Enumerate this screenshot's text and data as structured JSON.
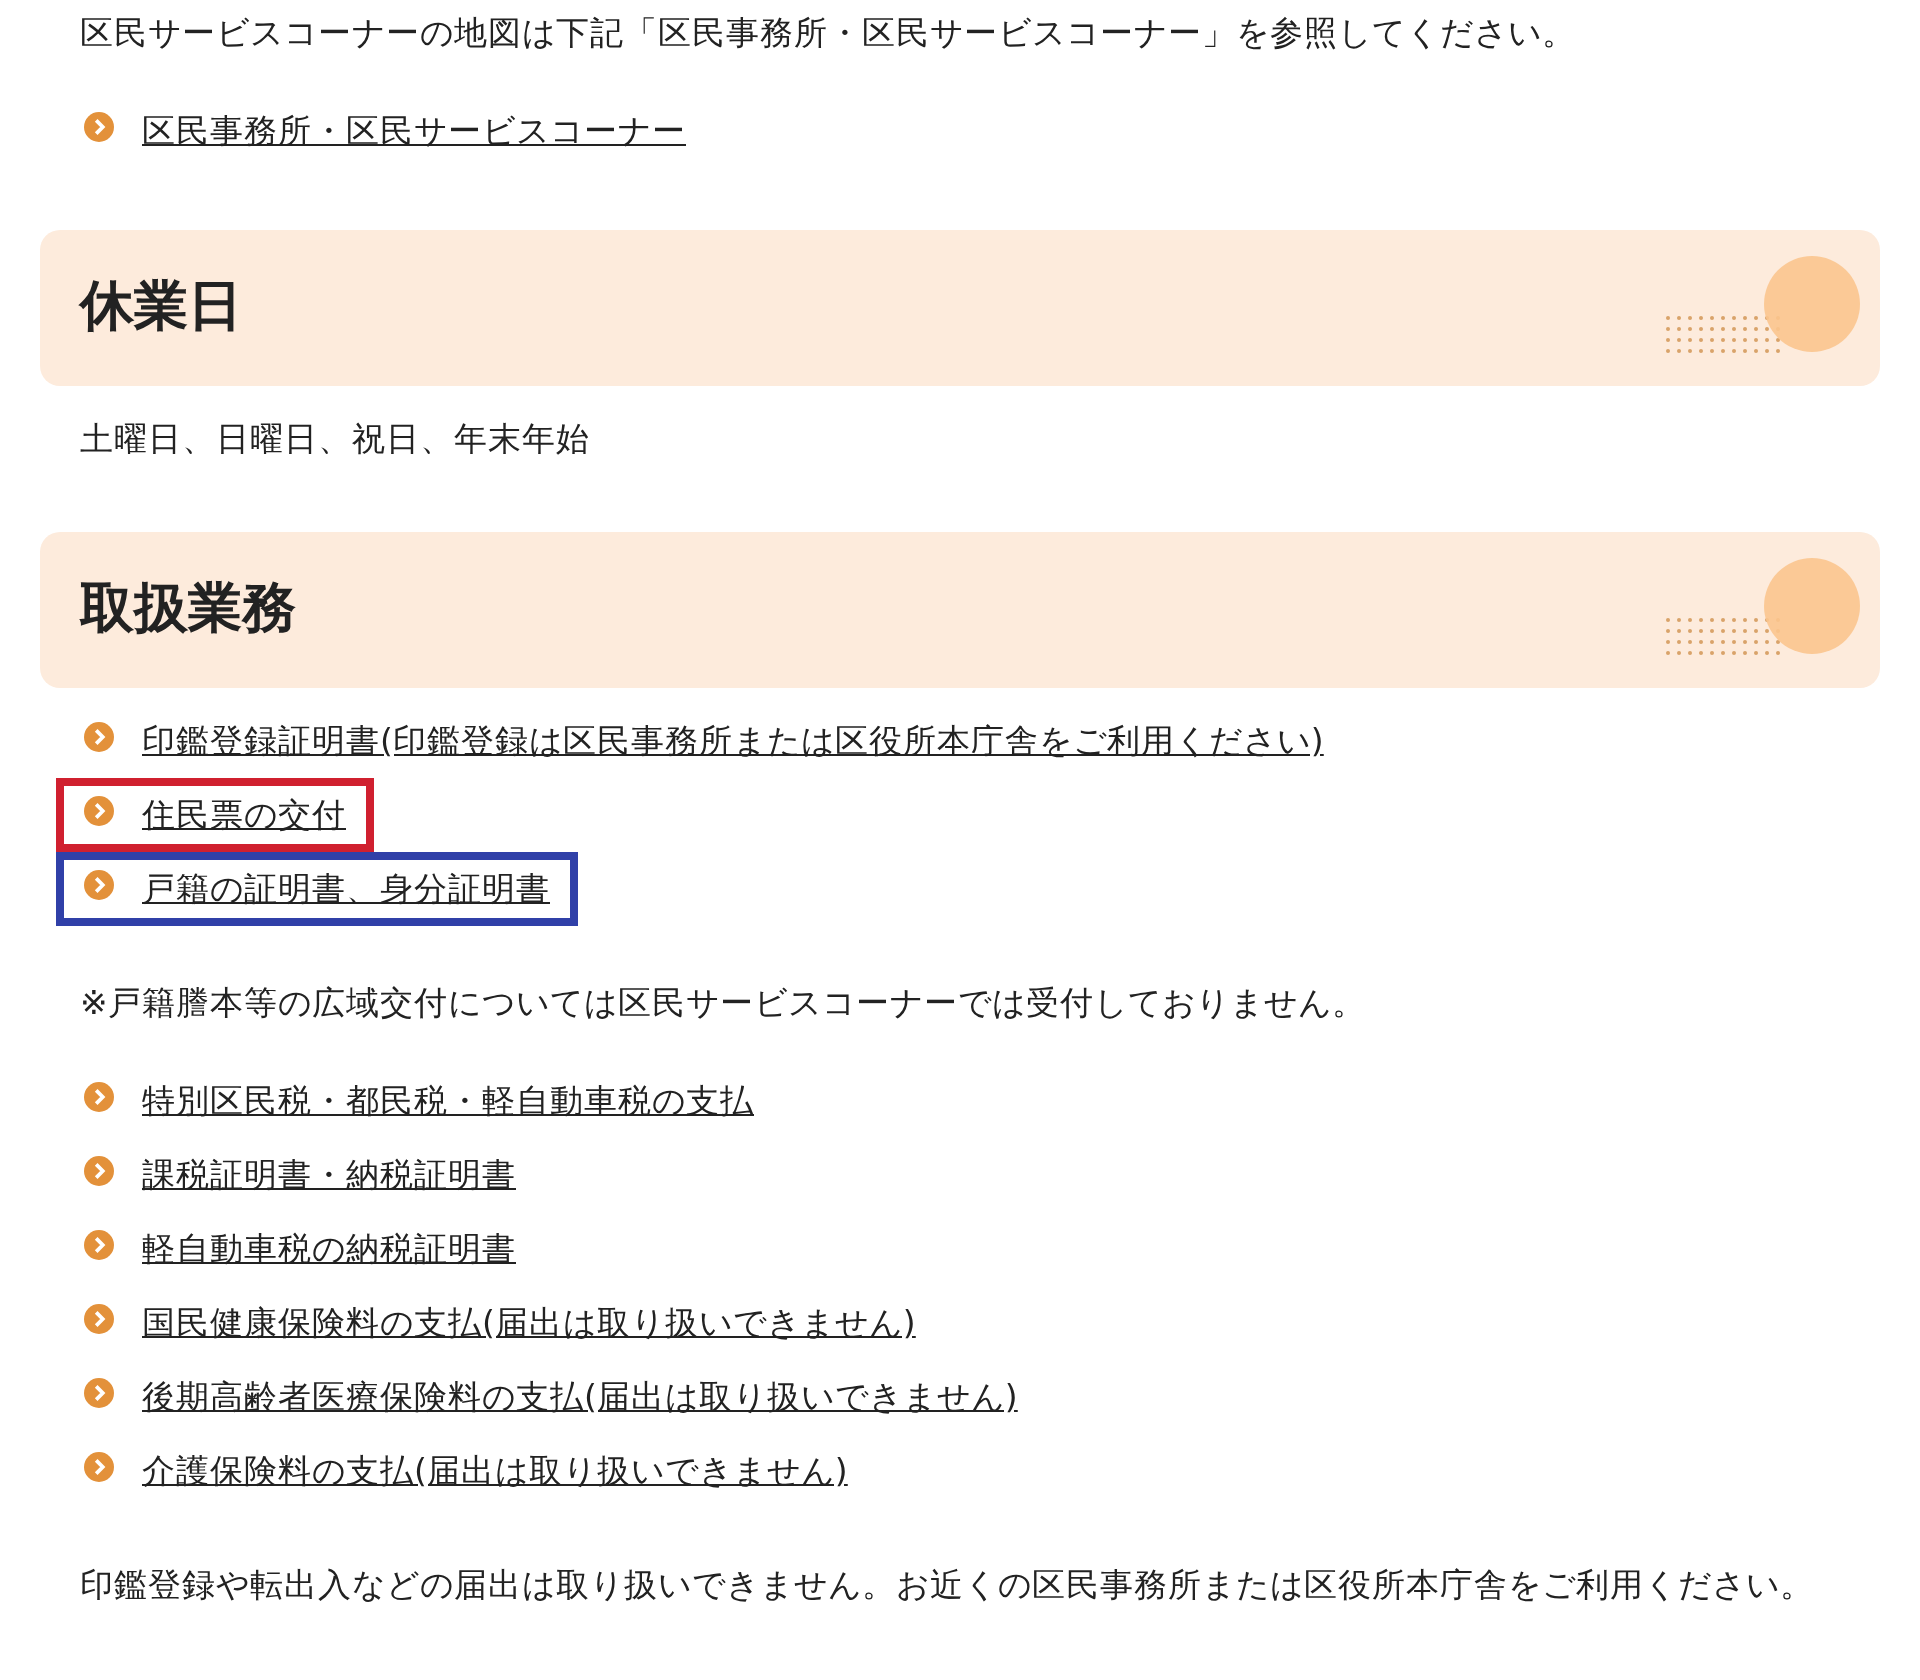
{
  "blocks": [
    {
      "kind": "paragraph",
      "text": "区民サービスコーナーの地図は下記「区民事務所・区民サービスコーナー」を参照してください。"
    },
    {
      "kind": "links",
      "items": [
        {
          "label": "区民事務所・区民サービスコーナー"
        }
      ]
    },
    {
      "kind": "heading",
      "text": "休業日"
    },
    {
      "kind": "paragraph",
      "text": "土曜日、日曜日、祝日、年末年始"
    },
    {
      "kind": "heading",
      "text": "取扱業務"
    },
    {
      "kind": "links",
      "items": [
        {
          "label": "印鑑登録証明書(印鑑登録は区民事務所または区役所本庁舎をご利用ください)"
        },
        {
          "label": "住民票の交付",
          "color": "#d0202f"
        },
        {
          "label": "戸籍の証明書、身分証明書",
          "color": "#3040a8"
        }
      ]
    },
    {
      "kind": "paragraph",
      "text": "※戸籍謄本等の広域交付については区民サービスコーナーでは受付しておりません。"
    },
    {
      "kind": "links",
      "items": [
        {
          "label": "特別区民税・都民税・軽自動車税の支払"
        },
        {
          "label": "課税証明書・納税証明書"
        },
        {
          "label": "軽自動車税の納税証明書"
        },
        {
          "label": "国民健康保険料の支払(届出は取り扱いできません)"
        },
        {
          "label": "後期高齢者医療保険料の支払(届出は取り扱いできません)"
        },
        {
          "label": "介護保険料の支払(届出は取り扱いできません)"
        }
      ]
    },
    {
      "kind": "paragraph",
      "text": "印鑑登録や転出入などの届出は取り扱いできません。お近くの区民事務所または区役所本庁舎をご利用ください。"
    }
  ]
}
